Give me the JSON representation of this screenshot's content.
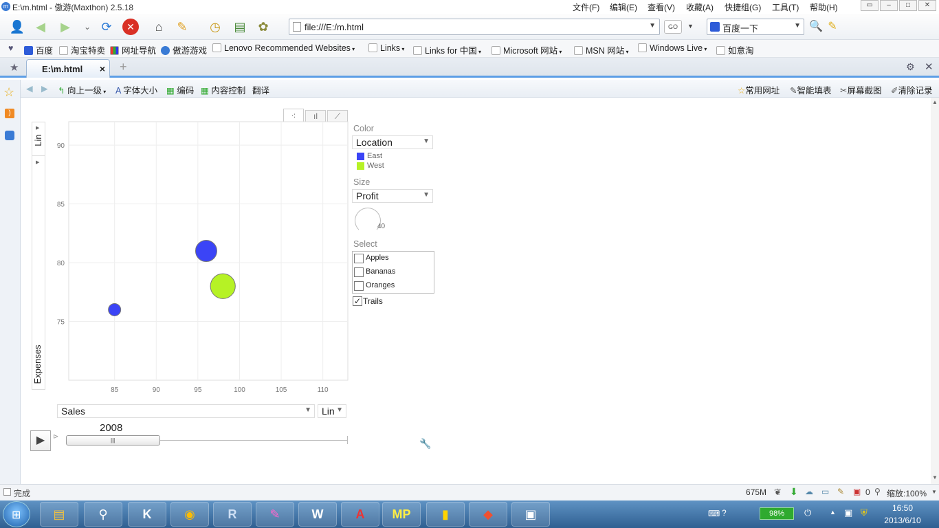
{
  "window": {
    "title": "E:\\m.html - 傲游(Maxthon) 2.5.18",
    "menu": [
      "文件(F)",
      "编辑(E)",
      "查看(V)",
      "收藏(A)",
      "快捷组(G)",
      "工具(T)",
      "帮助(H)"
    ]
  },
  "toolbar": {
    "url": "file:///E:/m.html",
    "search_value": "百度一下",
    "go_label": "GO"
  },
  "bookmarks": [
    {
      "label": "百度",
      "icon": "baidu-icon",
      "menu": false
    },
    {
      "label": "淘宝特卖",
      "icon": "page-icon",
      "menu": false
    },
    {
      "label": "网址导航",
      "icon": "grid-icon",
      "menu": false
    },
    {
      "label": "傲游游戏",
      "icon": "game-icon",
      "menu": false
    },
    {
      "label": "Lenovo Recommended Websites",
      "icon": "folder-icon",
      "menu": true
    },
    {
      "label": "Links",
      "icon": "folder-icon",
      "menu": true
    },
    {
      "label": "Links for 中国",
      "icon": "folder-icon",
      "menu": true
    },
    {
      "label": "Microsoft 网站",
      "icon": "folder-icon",
      "menu": true
    },
    {
      "label": "MSN 网站",
      "icon": "folder-icon",
      "menu": true
    },
    {
      "label": "Windows Live",
      "icon": "folder-icon",
      "menu": true
    },
    {
      "label": "如意淘",
      "icon": "page-icon",
      "menu": false
    }
  ],
  "tab": {
    "label": "E:\\m.html",
    "close": "×",
    "new_tab": "+"
  },
  "subbar": {
    "left": [
      "向上一级",
      "字体大小",
      "编码",
      "内容控制",
      "翻译"
    ],
    "right": [
      "常用网址",
      "智能填表",
      "屏幕截图",
      "清除记录"
    ]
  },
  "chart_data": {
    "type": "scatter",
    "subtype": "motion-bubble",
    "x_axis_select": "Sales",
    "x_scale": "Lin",
    "y_axis_label": "Expenses",
    "y_scale": "Lin",
    "xlim": [
      79.5,
      113
    ],
    "ylim": [
      70,
      92
    ],
    "xticks": [
      85,
      90,
      95,
      100,
      105,
      110
    ],
    "yticks": [
      75,
      80,
      85,
      90
    ],
    "grid": true,
    "year": "2008",
    "color_by": "Location",
    "size_by": "Profit",
    "size_legend_value": "40",
    "legend": [
      {
        "name": "East",
        "color": "#3b44f6"
      },
      {
        "name": "West",
        "color": "#b6f225"
      }
    ],
    "points": [
      {
        "x": 85,
        "y": 76,
        "location": "East",
        "color": "#3b44f6",
        "size": 0.75
      },
      {
        "x": 96,
        "y": 81,
        "location": "East",
        "color": "#3b44f6",
        "size": 1.0
      },
      {
        "x": 98,
        "y": 78,
        "location": "West",
        "color": "#b6f225",
        "size": 1.1
      }
    ]
  },
  "chart_controls": {
    "color_label": "Color",
    "color_value": "Location",
    "size_label": "Size",
    "size_value": "Profit",
    "select_label": "Select",
    "select_items": [
      "Apples",
      "Bananas",
      "Oranges"
    ],
    "trails_label": "Trails",
    "trails_checked": true,
    "y_scale_label": "Lin"
  },
  "status": {
    "left": "完成",
    "memory": "675M",
    "zero": "0",
    "zoom": "缩放:100%"
  },
  "taskbar": {
    "battery": "98%",
    "time": "16:50",
    "date": "2013/6/10",
    "apps": [
      "explorer",
      "search",
      "K",
      "chrome",
      "R",
      "paint",
      "W",
      "pdf",
      "MP",
      "notes",
      "git",
      "window"
    ]
  }
}
